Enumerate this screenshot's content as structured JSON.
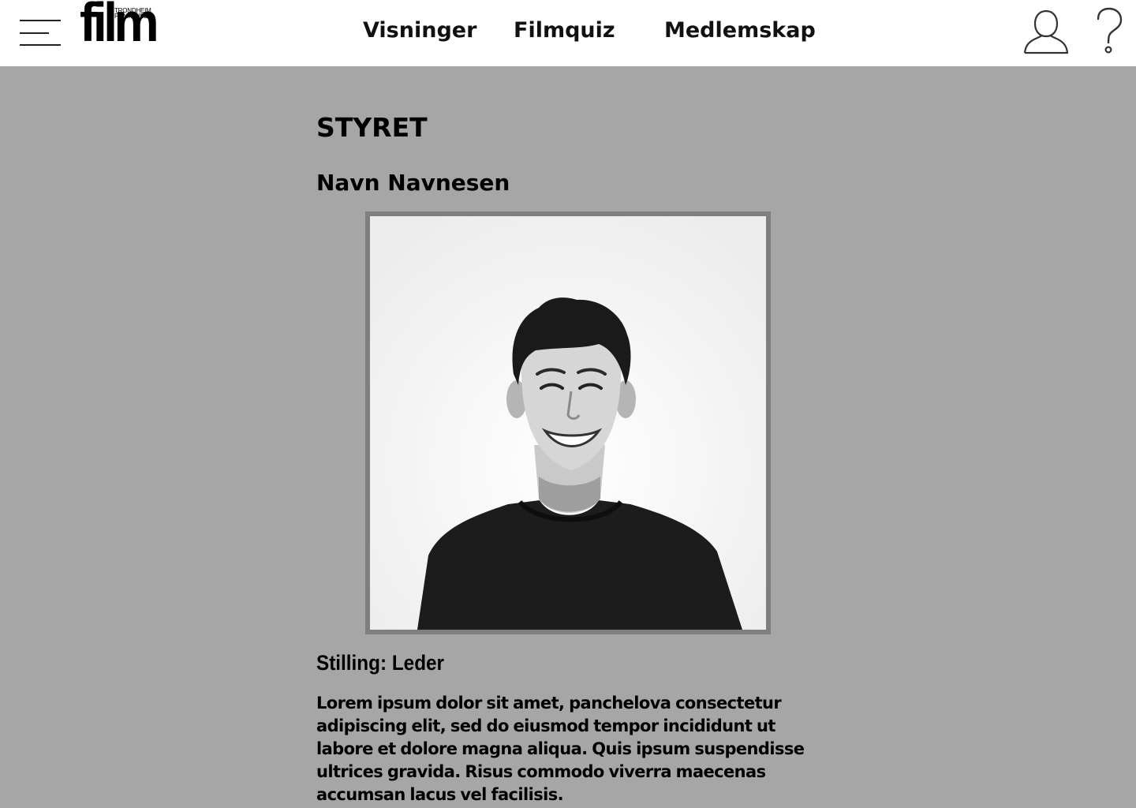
{
  "header": {
    "logo": {
      "word": "film",
      "line1": "TRONDHEIM",
      "line2": "FILMKLUBB"
    },
    "nav": [
      {
        "label": "Visninger"
      },
      {
        "label": "Filmquiz"
      },
      {
        "label": "Medlemskap"
      }
    ],
    "icons": [
      "menu-icon",
      "user-icon",
      "help-icon"
    ]
  },
  "main": {
    "section_title": "STYRET",
    "member": {
      "name": "Navn Navnesen",
      "position": "Stilling: Leder",
      "bio": "Lorem ipsum dolor sit amet, panchelova consectetur adipiscing elit, sed do eiusmod tempor incididunt ut labore et dolore magna aliqua. Quis ipsum suspendisse ultrices gravida. Risus commodo viverra maecenas accumsan lacus vel facilisis."
    }
  },
  "colors": {
    "page_background": "#a6a6a6",
    "header_background": "#ffffff",
    "photo_border": "#7f7f7f",
    "text": "#000000"
  }
}
